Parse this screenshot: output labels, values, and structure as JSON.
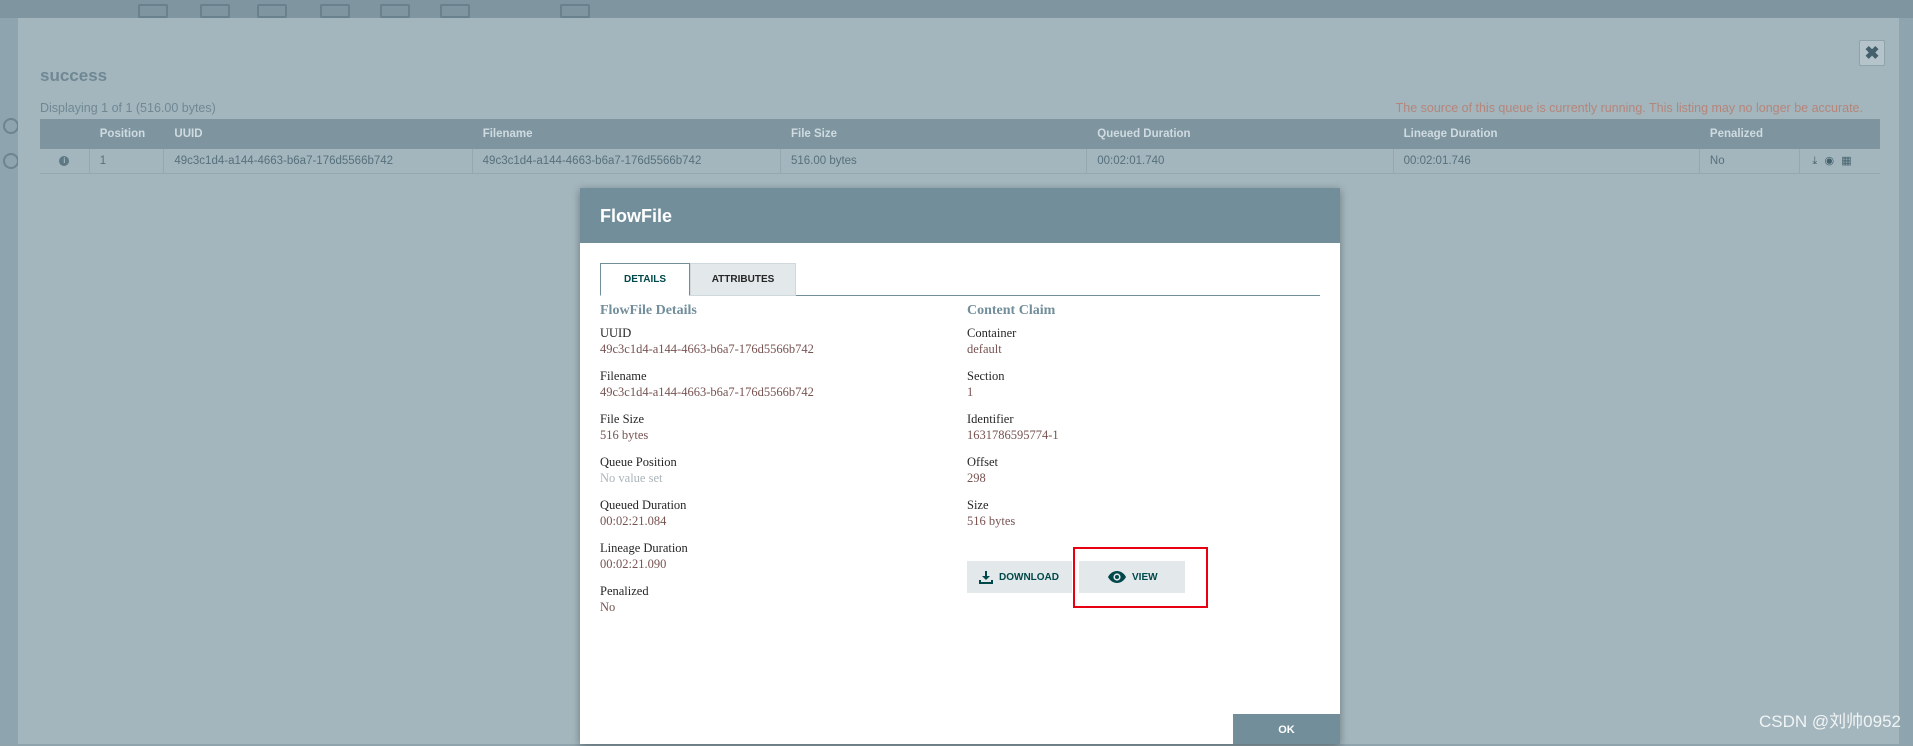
{
  "queue": {
    "title": "success",
    "summary": "Displaying 1 of 1 (516.00 bytes)",
    "warning": "The source of this queue is currently running. This listing may no longer be accurate.",
    "close_glyph": "✖",
    "columns": [
      "",
      "Position",
      "UUID",
      "Filename",
      "File Size",
      "Queued Duration",
      "Lineage Duration",
      "Penalized",
      ""
    ],
    "rows": [
      {
        "position": "1",
        "uuid": "49c3c1d4-a144-4663-b6a7-176d5566b742",
        "filename": "49c3c1d4-a144-4663-b6a7-176d5566b742",
        "file_size": "516.00 bytes",
        "queued_duration": "00:02:01.740",
        "lineage_duration": "00:02:01.746",
        "penalized": "No"
      }
    ]
  },
  "flowfile": {
    "title": "FlowFile",
    "tabs": [
      {
        "label": "DETAILS"
      },
      {
        "label": "ATTRIBUTES"
      }
    ],
    "details": {
      "heading": "FlowFile Details",
      "fields": [
        {
          "label": "UUID",
          "value": "49c3c1d4-a144-4663-b6a7-176d5566b742"
        },
        {
          "label": "Filename",
          "value": "49c3c1d4-a144-4663-b6a7-176d5566b742"
        },
        {
          "label": "File Size",
          "value": "516 bytes"
        },
        {
          "label": "Queue Position",
          "value": "No value set"
        },
        {
          "label": "Queued Duration",
          "value": "00:02:21.084"
        },
        {
          "label": "Lineage Duration",
          "value": "00:02:21.090"
        },
        {
          "label": "Penalized",
          "value": "No"
        }
      ]
    },
    "content_claim": {
      "heading": "Content Claim",
      "fields": [
        {
          "label": "Container",
          "value": "default"
        },
        {
          "label": "Section",
          "value": "1"
        },
        {
          "label": "Identifier",
          "value": "1631786595774-1"
        },
        {
          "label": "Offset",
          "value": "298"
        },
        {
          "label": "Size",
          "value": "516 bytes"
        }
      ]
    },
    "buttons": {
      "download": "DOWNLOAD",
      "view": "VIEW",
      "ok": "OK"
    }
  },
  "watermark": "CSDN @刘帅0952",
  "colors": {
    "header": "#728e9b",
    "value": "#775351",
    "highlight": "#e60012"
  }
}
